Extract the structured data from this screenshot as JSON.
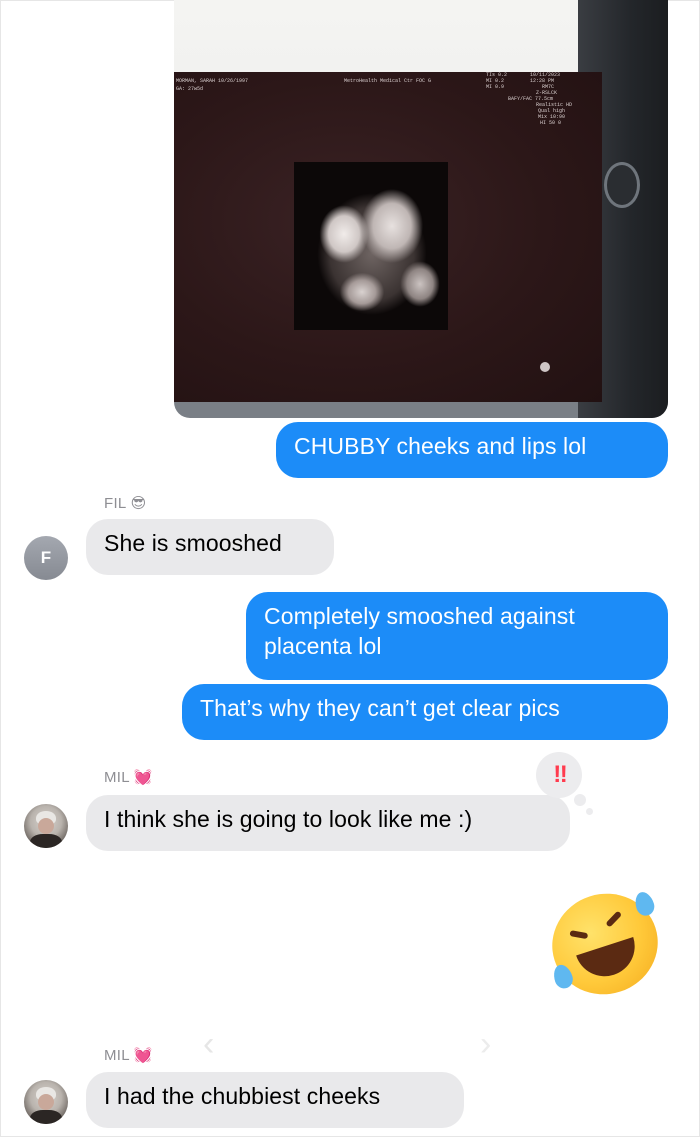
{
  "thread": {
    "photo": {
      "scan_header": {
        "patient": "MORMAN, SARAH 10/26/1997",
        "sub": "GA: 27w5d",
        "facility": "MetroHealth Medical Ctr FOC G",
        "settings": [
          "TIs 0.2",
          "MI 0.2",
          "MI 0.9"
        ],
        "datetime": [
          "10/11/2023",
          "12:28 PM"
        ],
        "params": [
          "RM7C",
          "Z-RSLCK",
          "BAFY/FAC 77.5cm",
          "Realistic HD",
          "Qual high",
          "Mix 10:90",
          "HI 50 0"
        ]
      }
    },
    "messages": [
      {
        "id": "m1",
        "direction": "outgoing",
        "text": "CHUBBY cheeks and lips lol"
      },
      {
        "id": "m2",
        "direction": "incoming",
        "sender": "FIL",
        "sender_emoji": "😎",
        "avatar_letter": "F",
        "text": "She is smooshed"
      },
      {
        "id": "m3",
        "direction": "outgoing",
        "text": "Completely smooshed against placenta lol"
      },
      {
        "id": "m4",
        "direction": "outgoing",
        "text": "That’s why they can’t get clear pics"
      },
      {
        "id": "m5",
        "direction": "incoming",
        "sender": "MIL",
        "sender_emoji": "💓",
        "text": "I think she is going to look like me :)",
        "tapback": "‼"
      },
      {
        "id": "m6",
        "direction": "outgoing",
        "emoji": "🤣"
      },
      {
        "id": "m7",
        "direction": "incoming",
        "sender": "MIL",
        "sender_emoji": "💓",
        "text": "I had the chubbiest cheeks"
      }
    ]
  },
  "colors": {
    "outgoing_bubble": "#1c8cf8",
    "incoming_bubble": "#e9e9eb",
    "sender_label": "#8e8e93",
    "tapback_mark": "#ff3b4e"
  },
  "icons": {
    "chevron_left": "chevron-left-icon",
    "chevron_right": "chevron-right-icon"
  }
}
